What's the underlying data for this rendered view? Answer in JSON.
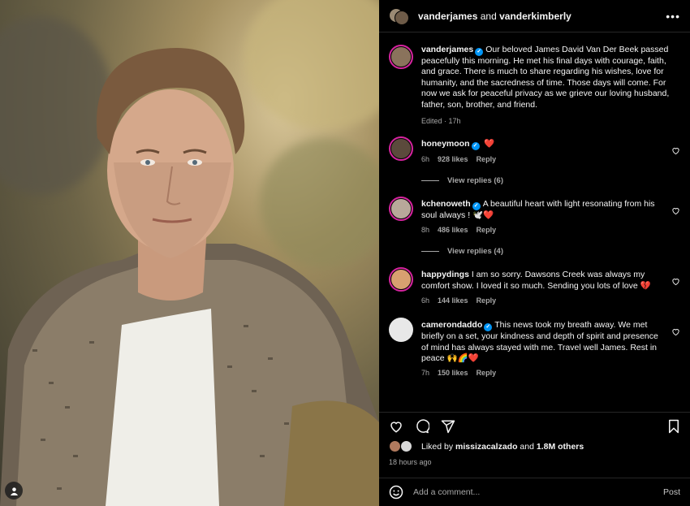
{
  "header": {
    "user_a": "vanderjames",
    "connector": "and",
    "user_b": "vanderkimberly",
    "more_label": "•••"
  },
  "caption": {
    "username": "vanderjames",
    "text": "Our beloved James David Van Der Beek passed peacefully this morning. He met his final days with courage, faith, and grace. There is much to share regarding his wishes, love for humanity, and the sacredness of time. Those days will come. For now we ask for peaceful privacy as we grieve our loving husband, father, son, brother, and friend.",
    "meta": "Edited · 17h"
  },
  "comments": [
    {
      "username": "honeymoon",
      "verified": true,
      "text": "❤️",
      "time": "6h",
      "likes": "928 likes",
      "reply": "Reply",
      "view_replies": "View replies (6)",
      "avatar_color": "#5b4a3c"
    },
    {
      "username": "kchenoweth",
      "verified": true,
      "text": "A beautiful heart with light resonating from his soul always ! 🕊️❤️",
      "time": "8h",
      "likes": "486 likes",
      "reply": "Reply",
      "view_replies": "View replies (4)",
      "avatar_color": "#b8a89a"
    },
    {
      "username": "happydings",
      "verified": false,
      "text": "I am so sorry. Dawsons Creek was always my comfort show. I loved it so much. Sending you lots of love 💔",
      "time": "6h",
      "likes": "144 likes",
      "reply": "Reply",
      "view_replies": "",
      "avatar_color": "#d8a070"
    },
    {
      "username": "camerondaddo",
      "verified": true,
      "text": "This news took my breath away. We met briefly on a set, your kindness and depth of spirit and presence of mind has always stayed with me. Travel well James. Rest in peace 🙌🌈❤️",
      "time": "7h",
      "likes": "150 likes",
      "reply": "Reply",
      "view_replies": "",
      "avatar_color": "#e8e8e8"
    }
  ],
  "likes": {
    "prefix": "Liked by",
    "user": "missizacalzado",
    "suffix": "and",
    "others": "1.8M others"
  },
  "timestamp": "18 hours ago",
  "comment_box": {
    "placeholder": "Add a comment...",
    "post_label": "Post"
  },
  "colors": {
    "background": "#000000",
    "verified": "#0095f6",
    "story_ring": "#d6249f",
    "muted_text": "#a8a8a8"
  },
  "icons": [
    "heart-icon",
    "comment-icon",
    "share-icon",
    "bookmark-icon",
    "emoji-icon",
    "more-icon",
    "tag-user-icon"
  ]
}
